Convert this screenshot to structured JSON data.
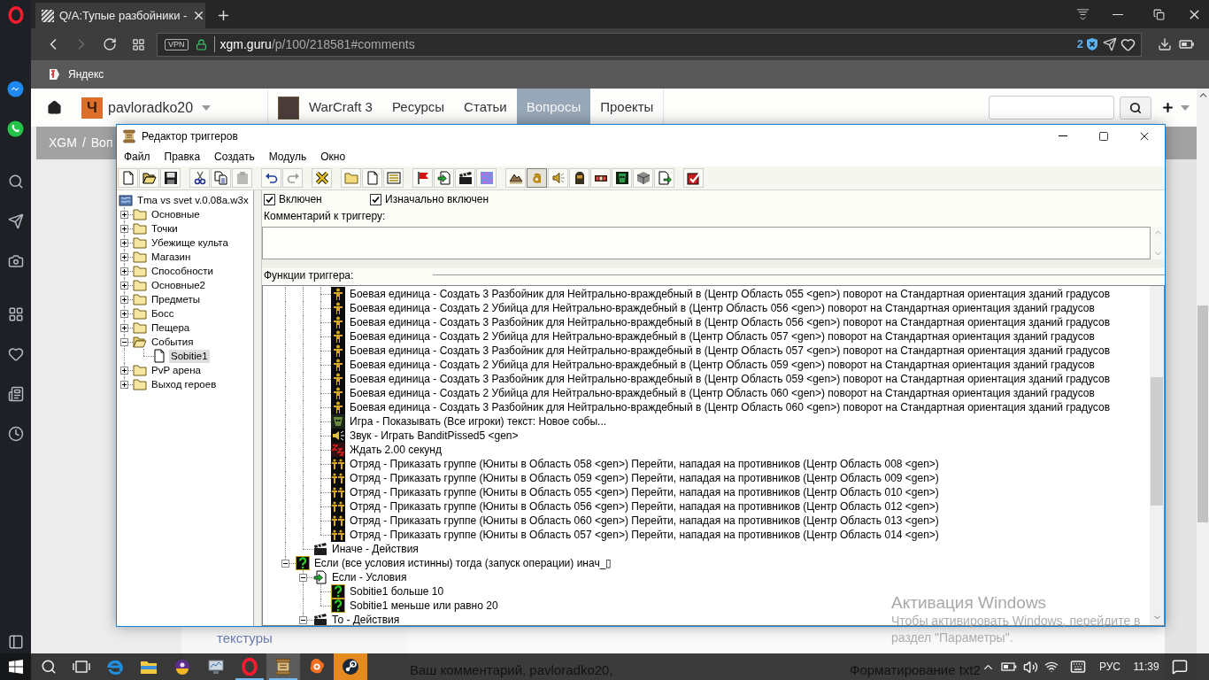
{
  "browser": {
    "tabs": [
      {
        "title": "Q/A:Тупые разбойники -",
        "selected": true
      }
    ],
    "address": {
      "vpn_badge": "VPN",
      "domain": "xgm.guru",
      "path": "/p/100/218581#comments",
      "blocked_count": "2"
    },
    "bookmarks": [
      {
        "label": "Яндекс"
      }
    ]
  },
  "site": {
    "avatar_letter": "Ч",
    "username": "pavloradko20",
    "nav": [
      {
        "label": "WarCraft 3",
        "kind": "game",
        "selected": false
      },
      {
        "label": "Ресурсы",
        "kind": "link",
        "selected": false
      },
      {
        "label": "Статьи",
        "kind": "link",
        "selected": false
      },
      {
        "label": "Вопросы",
        "kind": "link",
        "selected": true
      },
      {
        "label": "Проекты",
        "kind": "link",
        "selected": false
      }
    ],
    "breadcrumb": {
      "separator": "/",
      "items": [
        "XGM",
        "Воп"
      ]
    },
    "sidebar_link": "текстуры",
    "comment_prompt": "Ваш комментарий, pavloradko20,",
    "formatting_label": "Форматирование txt2"
  },
  "editor": {
    "title": "Редактор триггеров",
    "menu": [
      "Файл",
      "Правка",
      "Создать",
      "Модуль",
      "Окно"
    ],
    "toolbar": [
      {
        "buttons": [
          {
            "kind": "new",
            "disabled": false,
            "pressed": false
          },
          {
            "kind": "open",
            "disabled": false,
            "pressed": false
          },
          {
            "kind": "save",
            "disabled": false,
            "pressed": false
          }
        ]
      },
      {
        "buttons": [
          {
            "kind": "cut",
            "disabled": false,
            "pressed": false
          },
          {
            "kind": "copy",
            "disabled": false,
            "pressed": false
          },
          {
            "kind": "paste",
            "disabled": true,
            "pressed": false
          }
        ]
      },
      {
        "buttons": [
          {
            "kind": "undo",
            "disabled": false,
            "pressed": false
          },
          {
            "kind": "redo",
            "disabled": true,
            "pressed": false
          }
        ]
      },
      {
        "buttons": [
          {
            "kind": "variables",
            "disabled": false,
            "pressed": false
          }
        ]
      },
      {
        "buttons": [
          {
            "kind": "category",
            "disabled": false,
            "pressed": false
          },
          {
            "kind": "trigger",
            "disabled": false,
            "pressed": false
          },
          {
            "kind": "comment",
            "disabled": false,
            "pressed": false
          }
        ]
      },
      {
        "buttons": [
          {
            "kind": "event",
            "disabled": false,
            "pressed": false
          },
          {
            "kind": "condition",
            "disabled": false,
            "pressed": false
          },
          {
            "kind": "action",
            "disabled": false,
            "pressed": false
          },
          {
            "kind": "pattern",
            "disabled": false,
            "pressed": false
          }
        ]
      },
      {
        "buttons": [
          {
            "kind": "terrain",
            "disabled": false,
            "pressed": false
          },
          {
            "kind": "triggers",
            "disabled": false,
            "pressed": true
          },
          {
            "kind": "sound",
            "disabled": false,
            "pressed": false
          },
          {
            "kind": "objects",
            "disabled": false,
            "pressed": false
          },
          {
            "kind": "campaign",
            "disabled": false,
            "pressed": false
          },
          {
            "kind": "ai",
            "disabled": false,
            "pressed": false
          },
          {
            "kind": "manager",
            "disabled": false,
            "pressed": false
          },
          {
            "kind": "import",
            "disabled": false,
            "pressed": false
          }
        ]
      },
      {
        "buttons": [
          {
            "kind": "test",
            "disabled": false,
            "pressed": false
          }
        ]
      }
    ],
    "tree": {
      "label": "Tma vs svet v.0.08a.w3x",
      "kind": "map",
      "selected": false,
      "children": [
        {
          "label": "Основные",
          "kind": "folder",
          "expanded": false,
          "selected": false
        },
        {
          "label": "Точки",
          "kind": "folder",
          "expanded": false,
          "selected": false
        },
        {
          "label": "Убежище культа",
          "kind": "folder",
          "expanded": false,
          "selected": false
        },
        {
          "label": "Магазин",
          "kind": "folder",
          "expanded": false,
          "selected": false
        },
        {
          "label": "Способности",
          "kind": "folder",
          "expanded": false,
          "selected": false
        },
        {
          "label": "Основные2",
          "kind": "folder",
          "expanded": false,
          "selected": false
        },
        {
          "label": "Предметы",
          "kind": "folder",
          "expanded": false,
          "selected": false
        },
        {
          "label": "Босс",
          "kind": "folder",
          "expanded": false,
          "selected": false
        },
        {
          "label": "Пещера",
          "kind": "folder",
          "expanded": false,
          "selected": false
        },
        {
          "label": "События",
          "kind": "folder",
          "expanded": true,
          "selected": false,
          "children": [
            {
              "label": "Sobitie1",
              "kind": "trigger",
              "selected": true
            }
          ]
        },
        {
          "label": "PvP арена",
          "kind": "folder",
          "expanded": false,
          "selected": false
        },
        {
          "label": "Выход героев",
          "kind": "folder",
          "expanded": false,
          "selected": false
        }
      ]
    },
    "enabled": {
      "label": "Включен",
      "checked": true
    },
    "initially_on": {
      "label": "Изначально включен",
      "checked": true
    },
    "comment": {
      "label": "Комментарий к триггеру:"
    },
    "functions": {
      "label": "Функции триггера:",
      "tree": [
        {
          "children": [
            {
              "children": [
                {
                  "kind": "unit",
                  "label": "Боевая единица - Создать 3 Разбойник для Нейтрально-враждебный в (Центр Область 055 <gen>) поворот на Стандартная ориентация зданий градусов"
                },
                {
                  "kind": "unit",
                  "label": "Боевая единица - Создать 2 Убийца для Нейтрально-враждебный в (Центр Область 056 <gen>) поворот на Стандартная ориентация зданий градусов"
                },
                {
                  "kind": "unit",
                  "label": "Боевая единица - Создать 3 Разбойник для Нейтрально-враждебный в (Центр Область 056 <gen>) поворот на Стандартная ориентация зданий градусов"
                },
                {
                  "kind": "unit",
                  "label": "Боевая единица - Создать 2 Убийца для Нейтрально-враждебный в (Центр Область 057 <gen>) поворот на Стандартная ориентация зданий градусов"
                },
                {
                  "kind": "unit",
                  "label": "Боевая единица - Создать 3 Разбойник для Нейтрально-враждебный в (Центр Область 057 <gen>) поворот на Стандартная ориентация зданий градусов"
                },
                {
                  "kind": "unit",
                  "label": "Боевая единица - Создать 2 Убийца для Нейтрально-враждебный в (Центр Область 059 <gen>) поворот на Стандартная ориентация зданий градусов"
                },
                {
                  "kind": "unit",
                  "label": "Боевая единица - Создать 3 Разбойник для Нейтрально-враждебный в (Центр Область 059 <gen>) поворот на Стандартная ориентация зданий градусов"
                },
                {
                  "kind": "unit",
                  "label": "Боевая единица - Создать 2 Убийца для Нейтрально-враждебный в (Центр Область 060 <gen>) поворот на Стандартная ориентация зданий градусов"
                },
                {
                  "kind": "unit",
                  "label": "Боевая единица - Создать 3 Разбойник для Нейтрально-враждебный в (Центр Область 060 <gen>) поворот на Стандартная ориентация зданий градусов"
                },
                {
                  "kind": "game",
                  "label": "Игра - Показывать (Все игроки) текст: Новое собы..."
                },
                {
                  "kind": "sound",
                  "label": "Звук - Играть BanditPissed5 <gen>"
                },
                {
                  "kind": "wait",
                  "label": "Ждать 2.00 секунд"
                },
                {
                  "kind": "group",
                  "label": "Отряд - Приказать группе (Юниты в Область 058 <gen>) Перейти, нападая на противников (Центр Область 008 <gen>)"
                },
                {
                  "kind": "group",
                  "label": "Отряд - Приказать группе (Юниты в Область 059 <gen>) Перейти, нападая на противников (Центр Область 009 <gen>)"
                },
                {
                  "kind": "group",
                  "label": "Отряд - Приказать группе (Юниты в Область 055 <gen>) Перейти, нападая на противников (Центр Область 010 <gen>)"
                },
                {
                  "kind": "group",
                  "label": "Отряд - Приказать группе (Юниты в Область 056 <gen>) Перейти, нападая на противников (Центр Область 012 <gen>)"
                },
                {
                  "kind": "group",
                  "label": "Отряд - Приказать группе (Юниты в Область 060 <gen>) Перейти, нападая на противников (Центр Область 013 <gen>)"
                },
                {
                  "kind": "group",
                  "label": "Отряд - Приказать группе (Юниты в Область 057 <gen>) Перейти, нападая на противников (Центр Область 014 <gen>)"
                }
              ]
            },
            {
              "kind": "actions",
              "label": "Иначе - Действия"
            }
          ]
        },
        {
          "kind": "condition",
          "label": "Если (все условия истинны) тогда (запуск операции) инач_▯",
          "expanded": true,
          "children": [
            {
              "kind": "conditions",
              "label": "Если - Условия",
              "expanded": true,
              "children": [
                {
                  "kind": "condition",
                  "label": "Sobitie1 больше 10"
                },
                {
                  "kind": "condition",
                  "label": "Sobitie1 меньше или равно 20"
                }
              ]
            },
            {
              "kind": "actions",
              "label": "То - Действия",
              "expanded": true
            }
          ]
        }
      ]
    }
  },
  "activation_notice": {
    "title": "Активация Windows",
    "text": "Чтобы активировать Windows, перейдите в раздел \"Параметры\"."
  },
  "taskbar": {
    "apps": [
      {
        "kind": "edge",
        "running": false,
        "active": false,
        "attention": false
      },
      {
        "kind": "explorer",
        "running": false,
        "active": false,
        "attention": false
      },
      {
        "kind": "badge",
        "running": false,
        "active": false,
        "attention": false
      },
      {
        "kind": "monitor",
        "running": false,
        "active": false,
        "attention": false
      },
      {
        "kind": "opera",
        "running": true,
        "active": false,
        "attention": false
      },
      {
        "kind": "editor",
        "running": true,
        "active": true,
        "attention": false
      },
      {
        "kind": "avast",
        "running": false,
        "active": false,
        "attention": false
      },
      {
        "kind": "steam",
        "running": false,
        "active": false,
        "attention": true
      }
    ],
    "tray": {
      "language": "РУС",
      "time": "11:39"
    }
  }
}
